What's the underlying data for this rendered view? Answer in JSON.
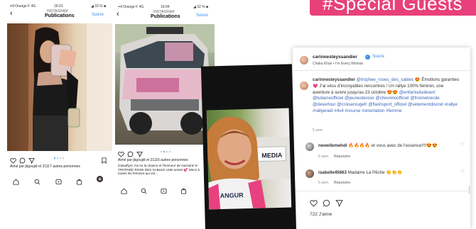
{
  "banner": {
    "text": "#Special Guests",
    "color": "#e8407a"
  },
  "phone1": {
    "status_left": "••ll Orange F  4G",
    "status_time": "16:01",
    "status_right": "◢ 33 % ■",
    "handle": "INSTAGRAM",
    "title": "Publications",
    "follow": "Suivre",
    "likes": "Aimé par jbgoujdi et 21117 autres personnes"
  },
  "phone2": {
    "status_left": "••ll Orange F  4G",
    "status_time": "16:04",
    "status_right": "◢ 32 % ■",
    "handle": "INSTAGRAM",
    "title": "Publications",
    "follow": "Suivre",
    "likes": "Aimé par jbgoujdi et 21116 autres personnes",
    "caption": "instaoflyre J'ai eu la chance et l'honneur de marraine le TROPHÉE ROSE DES SABLES cette année 💕 Merci à toutes les femmes qui ont..."
  },
  "post": {
    "username": "carinnesteyssandier",
    "verified_icon": "verified-badge",
    "follow": "Suivre",
    "audio": "Chaka Khan • I'm Every Woman",
    "author": "carinnesteyssandier",
    "mention": "@trophee_roses_des_sables",
    "text_1": "😍 Émotions garanties 💗 J'ai vécu d'incroyables rencontres ! Un rallye 100% féminin, une aventure à suivre jusqu'au 23 octobre 😍😍",
    "hashtags": "@enfantsdudesert @tubarreofficiel @jeunesterose @chevreloofficiel @fronnetcecile @desertour @croiserougefr @flashsport_officiel @vetementdiscret #rallye #rallyeraid #4x4 #course #orientation #femme",
    "time": "5 sem.",
    "comment1_user": "newellemehdi",
    "comment1_text": "🔥🔥🔥🔥 et vous avec de l'essence!!!!😍😍",
    "comment1_time": "5 sem.",
    "comment1_reply": "Répondre",
    "comment2_user": "isabelle45663",
    "comment2_text": "Madame La Pêche 👏👏👏",
    "comment2_time": "5 sem.",
    "comment2_reply": "Répondre",
    "likes": "722 J'aime"
  },
  "media_sign": "MEDIA",
  "shirt_text": "ANGUR"
}
